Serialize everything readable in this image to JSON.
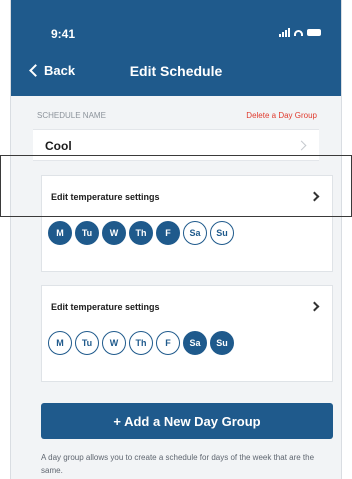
{
  "status_bar": {
    "time": "9:41"
  },
  "nav": {
    "back_label": "Back",
    "title": "Edit Schedule"
  },
  "schedule": {
    "section_label": "SCHEDULE NAME",
    "delete_label": "Delete a Day Group",
    "name": "Cool"
  },
  "day_groups": [
    {
      "title": "Edit temperature settings",
      "days": [
        {
          "label": "M",
          "selected": true
        },
        {
          "label": "Tu",
          "selected": true
        },
        {
          "label": "W",
          "selected": true
        },
        {
          "label": "Th",
          "selected": true
        },
        {
          "label": "F",
          "selected": true
        },
        {
          "label": "Sa",
          "selected": false
        },
        {
          "label": "Su",
          "selected": false
        }
      ]
    },
    {
      "title": "Edit temperature settings",
      "days": [
        {
          "label": "M",
          "selected": false
        },
        {
          "label": "Tu",
          "selected": false
        },
        {
          "label": "W",
          "selected": false
        },
        {
          "label": "Th",
          "selected": false
        },
        {
          "label": "F",
          "selected": false
        },
        {
          "label": "Sa",
          "selected": true
        },
        {
          "label": "Su",
          "selected": true
        }
      ]
    }
  ],
  "add_button_label": "+ Add a New Day Group",
  "help_text": "A day group allows you to create a schedule for days of the week that are the same.",
  "colors": {
    "primary": "#1f5a8c",
    "danger": "#e03b2f",
    "background": "#f2f4f6"
  }
}
